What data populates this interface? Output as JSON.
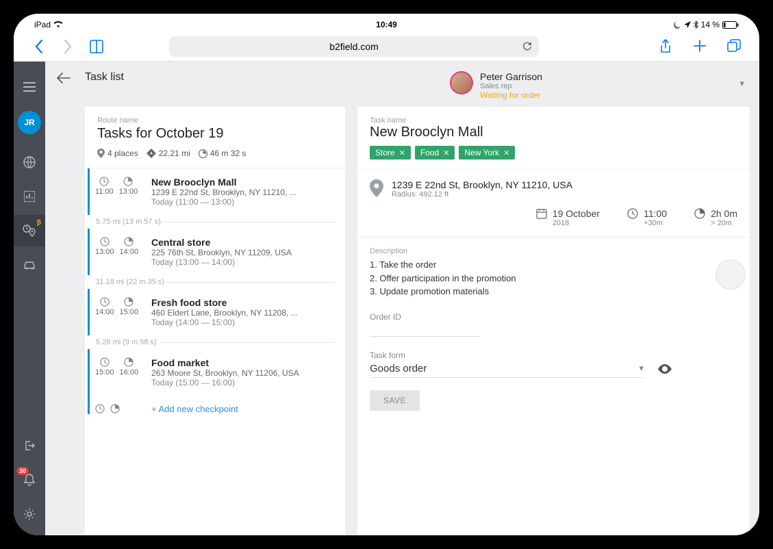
{
  "status_bar": {
    "device": "iPad",
    "time": "10:49",
    "battery_text": "14 %"
  },
  "safari": {
    "url": "b2field.com"
  },
  "rail": {
    "avatar_initials": "JR",
    "notif_count": "30",
    "beta_mark": "β"
  },
  "header": {
    "back_label": "Task list"
  },
  "assignee": {
    "name": "Peter Garrison",
    "role": "Sales rep",
    "status": "Waiting for order"
  },
  "route": {
    "label": "Route name",
    "title": "Tasks for October 19",
    "places": "4 places",
    "distance": "22.21 mi",
    "duration": "46 m 32 s"
  },
  "tasks": [
    {
      "start": "11:00",
      "end": "13:00",
      "name": "New Brooclyn Mall",
      "addr": "1239 E 22nd St, Brooklyn, NY 11210, ...",
      "window": "Today (11:00 — 13:00)"
    },
    {
      "start": "13:00",
      "end": "14:00",
      "name": "Central store",
      "addr": "225 76th St, Brooklyn, NY 11209, USA",
      "window": "Today (13:00 — 14:00)"
    },
    {
      "start": "14:00",
      "end": "15:00",
      "name": "Fresh food store",
      "addr": "460 Eldert Lane, Brooklyn, NY 11208, ...",
      "window": "Today (14:00 — 15:00)"
    },
    {
      "start": "15:00",
      "end": "16:00",
      "name": "Food market",
      "addr": "263 Moore St, Brooklyn, NY 11206, USA",
      "window": "Today (15:00 — 16:00)"
    }
  ],
  "dividers": [
    "5.75 mi (13 m 57 s)",
    "11.18 mi (22 m 35 s)",
    "5.28 mi (9 m 58 s)"
  ],
  "add_checkpoint": "+ Add new checkpoint",
  "detail": {
    "label": "Task name",
    "title": "New Brooclyn Mall",
    "tags": [
      "Store",
      "Food",
      "New York"
    ],
    "address": "1239 E 22nd St, Brooklyn, NY 11210, USA",
    "radius": "Radius: 492.12 ft",
    "date": "19 October",
    "year": "2018",
    "time": "11:00",
    "time_sub": "+30m",
    "duration": "2h 0m",
    "duration_sub": "> 20m",
    "desc_label": "Description",
    "desc": [
      "1. Take the order",
      "2. Offer participation in the promotion",
      "3. Update promotion materials"
    ],
    "order_label": "Order ID",
    "form_label": "Task form",
    "form_value": "Goods order",
    "save": "SAVE"
  }
}
